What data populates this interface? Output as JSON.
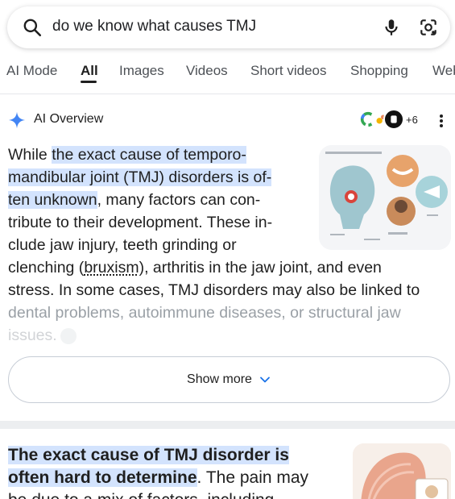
{
  "search": {
    "query": "do we know what causes TMJ"
  },
  "tabs": [
    {
      "label": "AI Mode"
    },
    {
      "label": "All"
    },
    {
      "label": "Images"
    },
    {
      "label": "Videos"
    },
    {
      "label": "Short videos"
    },
    {
      "label": "Shopping"
    },
    {
      "label": "Web"
    }
  ],
  "active_tab": "All",
  "ai_overview": {
    "title": "AI Overview",
    "sources_more": "+6",
    "lines": [
      {
        "a": "While ",
        "h": "the exact cause of temporo-",
        "b": ""
      },
      {
        "a": "",
        "h": "mandibular joint (TMJ) disorders is of-",
        "b": ""
      },
      {
        "a": "",
        "h": "ten unknown",
        "b": ", many factors can con-"
      },
      {
        "a": "tribute to their development. These in-",
        "h": "",
        "b": ""
      },
      {
        "a": "clude jaw injury, teeth grinding or",
        "h": "",
        "b": ""
      },
      {
        "a": "clenching (",
        "u": "bruxism",
        "b": "), arthritis in the jaw joint, and even"
      },
      {
        "a": "stress. In some cases, TMJ disorders may also be linked to"
      },
      {
        "a": "dental problems, autoimmune diseases, or structural jaw"
      },
      {
        "a": "issues."
      }
    ],
    "show_more_label": "Show more"
  },
  "next_result": {
    "highlight_1": "The exact cause of TMJ disorder is",
    "highlight_2": "often hard to determine",
    "rest_2": ". The pain may",
    "line_3": "be due to a mix of factors, including"
  },
  "colors": {
    "highlight": "#d3e3fd",
    "ai_spark": "#4285f4"
  }
}
